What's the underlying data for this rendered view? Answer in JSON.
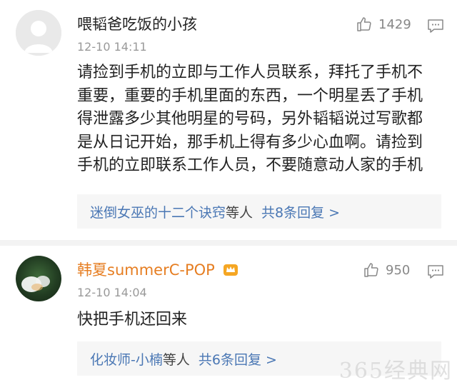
{
  "comments": [
    {
      "username": "喂韬爸吃饭的小孩",
      "timestamp": "12-10 14:11",
      "likes": "1429",
      "text": "请捡到手机的立即与工作人员联系，拜托了手机不\n重要，重要的手机里面的东西，一个明星丢了手机\n得泄露多少其他明星的号码，另外韬韬说过写歌都\n是从日记开始，那手机上得有多少心血啊。请捡到\n手机的立即联系工作人员，不要随意动人家的手机",
      "replies": {
        "names": "迷倒女巫的十二个诀窍",
        "suffix": "等人",
        "count": "共8条回复 >"
      }
    },
    {
      "username": "韩夏summerC-POP",
      "timestamp": "12-10 14:04",
      "likes": "950",
      "text": "快把手机还回来",
      "replies": {
        "names": "化妆师-小楠",
        "suffix": "等人",
        "count": "共6条回复 >"
      }
    }
  ],
  "watermark": "365经典网",
  "icons": {
    "like": "thumbs-up-icon",
    "reply": "comment-bubble-icon",
    "badge": "vip-crown-icon"
  },
  "colors": {
    "link": "#4a77b4",
    "vip_name": "#e67e22",
    "muted": "#999999"
  }
}
